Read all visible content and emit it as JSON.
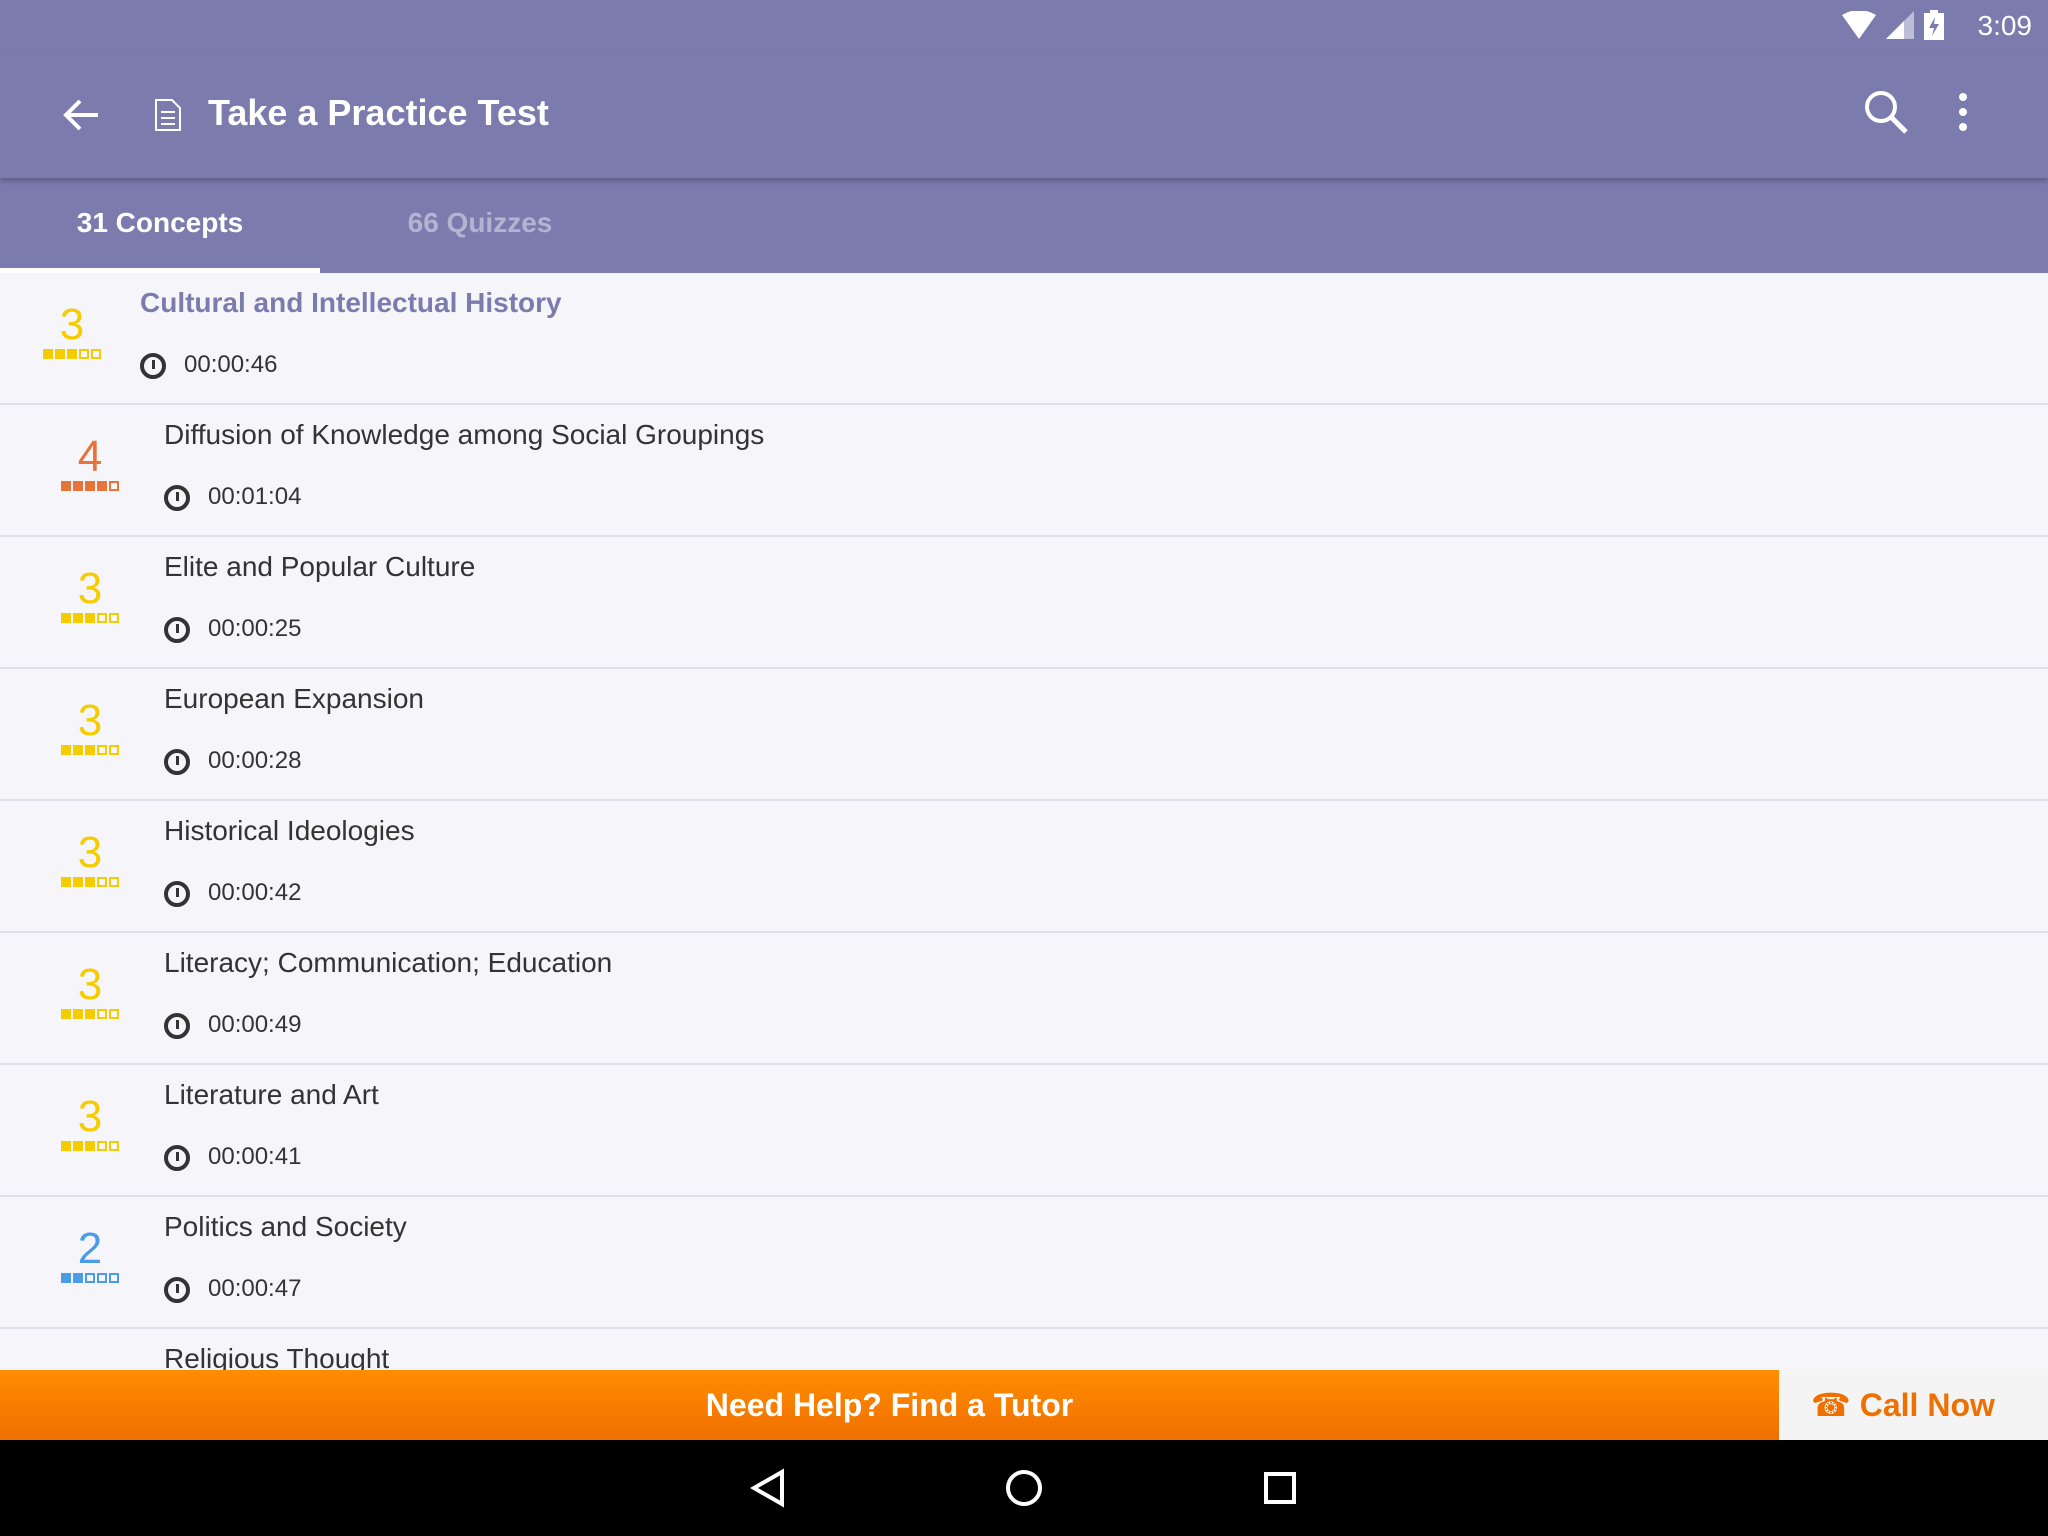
{
  "status_bar": {
    "time": "3:09",
    "icons": [
      "wifi-icon",
      "signal-icon",
      "battery-charging-icon"
    ]
  },
  "toolbar": {
    "title": "Take a Practice Test",
    "icons": [
      "back-arrow-icon",
      "document-icon",
      "search-icon",
      "more-vert-icon"
    ]
  },
  "tabs": [
    {
      "label": "31 Concepts",
      "active": true
    },
    {
      "label": "66 Quizzes",
      "active": false
    }
  ],
  "colors": {
    "header": "#7b7bae",
    "level3": "#f5cc00",
    "level4": "#e8733a",
    "level2": "#4a9be8",
    "banner": "#f78000"
  },
  "concepts": [
    {
      "name": "Cultural and Intellectual History",
      "level": "3",
      "duration": "00:00:46",
      "color": "#f5cc00",
      "filled": 3,
      "selected": true
    },
    {
      "name": "Diffusion of Knowledge among Social Groupings",
      "level": "4",
      "duration": "00:01:04",
      "color": "#e8733a",
      "filled": 4
    },
    {
      "name": "Elite and Popular Culture",
      "level": "3",
      "duration": "00:00:25",
      "color": "#f5cc00",
      "filled": 3
    },
    {
      "name": "European Expansion",
      "level": "3",
      "duration": "00:00:28",
      "color": "#f5cc00",
      "filled": 3
    },
    {
      "name": "Historical Ideologies",
      "level": "3",
      "duration": "00:00:42",
      "color": "#f5cc00",
      "filled": 3
    },
    {
      "name": "Literacy; Communication; Education",
      "level": "3",
      "duration": "00:00:49",
      "color": "#f5cc00",
      "filled": 3
    },
    {
      "name": "Literature and Art",
      "level": "3",
      "duration": "00:00:41",
      "color": "#f5cc00",
      "filled": 3
    },
    {
      "name": "Politics and Society",
      "level": "2",
      "duration": "00:00:47",
      "color": "#4a9be8",
      "filled": 2
    },
    {
      "name": "Religious Thought"
    }
  ],
  "banner": {
    "label": "Need Help? Find a Tutor",
    "call_label": "Call Now"
  }
}
